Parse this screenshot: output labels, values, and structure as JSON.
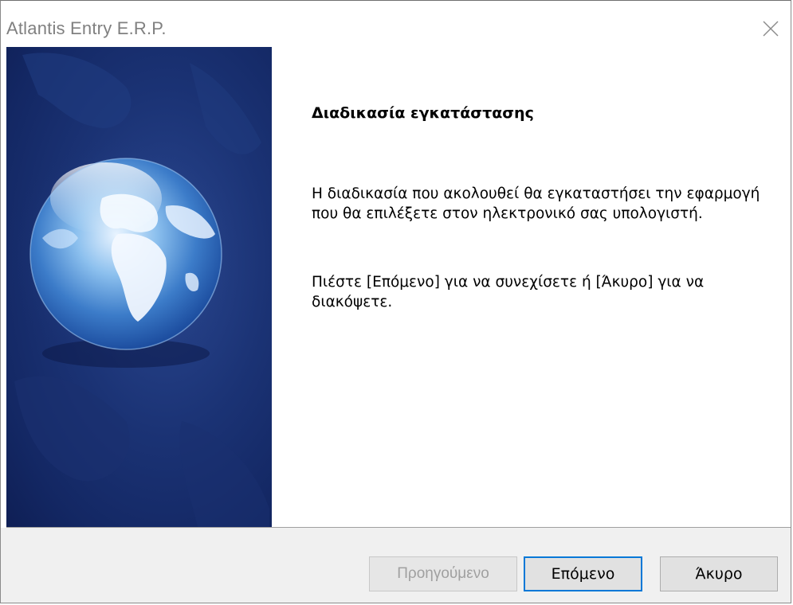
{
  "window": {
    "title": "Atlantis Entry E.R.P."
  },
  "content": {
    "heading": "Διαδικασία εγκατάστασης",
    "paragraph1": "Η διαδικασία που ακολουθεί θα εγκαταστήσει την εφαρμογή που θα επιλέξετε στον ηλεκτρονικό σας υπολογιστή.",
    "paragraph2": "Πιέστε [Επόμενο] για να συνεχίσετε ή [Άκυρο] για να διακόψετε."
  },
  "buttons": {
    "previous": "Προηγούμενο",
    "next": "Επόμενο",
    "cancel": "Άκυρο",
    "previous_enabled": false
  },
  "icons": {
    "close": "close-icon",
    "banner": "globe-icon"
  },
  "colors": {
    "banner_blue": "#1b3375",
    "focus_border": "#0078d7",
    "footer_bg": "#f0f0f0"
  }
}
